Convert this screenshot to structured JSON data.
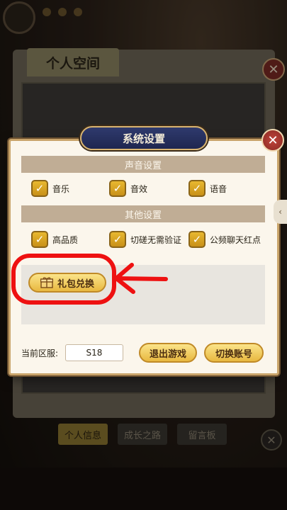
{
  "book": {
    "title": "个人空间"
  },
  "bottom_tabs": [
    "个人信息",
    "成长之路",
    "留言板"
  ],
  "dialog": {
    "title": "系统设置",
    "sound_section": "声音设置",
    "sound_options": [
      {
        "label": "音乐",
        "checked": true
      },
      {
        "label": "音效",
        "checked": true
      },
      {
        "label": "语音",
        "checked": true
      }
    ],
    "other_section": "其他设置",
    "other_options": [
      {
        "label": "高品质",
        "checked": true
      },
      {
        "label": "切磋无需验证",
        "checked": true
      },
      {
        "label": "公频聊天红点",
        "checked": true
      }
    ],
    "gift_button": "礼包兑换",
    "server_label": "当前区服:",
    "server_value": "S18",
    "logout_button": "退出游戏",
    "switch_account_button": "切换账号"
  },
  "colors": {
    "annotation": "#ee1111",
    "section_bar": "#c0ad95",
    "button_gold": "#e8b840",
    "title_navy": "#1e2650"
  }
}
